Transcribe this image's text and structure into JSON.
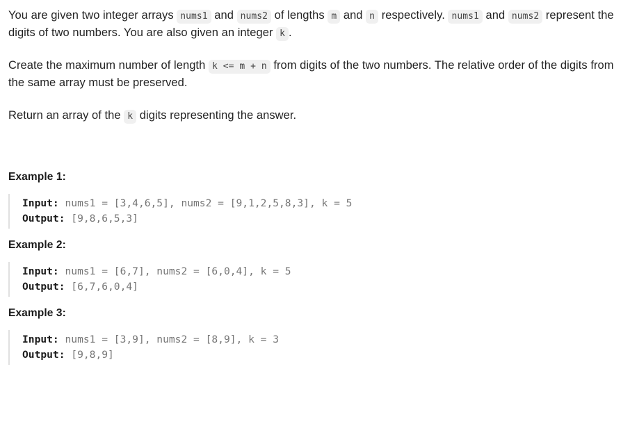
{
  "problem": {
    "paragraphs": [
      {
        "id": "p1",
        "segments": [
          {
            "type": "text",
            "value": "You are given two integer arrays "
          },
          {
            "type": "code",
            "value": "nums1"
          },
          {
            "type": "text",
            "value": " and "
          },
          {
            "type": "code",
            "value": "nums2"
          },
          {
            "type": "text",
            "value": " of lengths "
          },
          {
            "type": "code",
            "value": "m"
          },
          {
            "type": "text",
            "value": " and "
          },
          {
            "type": "code",
            "value": "n"
          },
          {
            "type": "text",
            "value": " respectively. "
          },
          {
            "type": "code",
            "value": "nums1"
          },
          {
            "type": "text",
            "value": " and "
          },
          {
            "type": "code",
            "value": "nums2"
          },
          {
            "type": "text",
            "value": " represent the digits of two numbers. You are also given an integer "
          },
          {
            "type": "code",
            "value": "k"
          },
          {
            "type": "text",
            "value": "."
          }
        ]
      },
      {
        "id": "p2",
        "segments": [
          {
            "type": "text",
            "value": "Create the maximum number of length "
          },
          {
            "type": "code",
            "value": "k <= m + n"
          },
          {
            "type": "text",
            "value": " from digits of the two numbers. The relative order of the digits from the same array must be preserved."
          }
        ]
      },
      {
        "id": "p3",
        "segments": [
          {
            "type": "text",
            "value": "Return an array of the "
          },
          {
            "type": "code",
            "value": "k"
          },
          {
            "type": "text",
            "value": " digits representing the answer."
          }
        ]
      }
    ],
    "examples": [
      {
        "title": "Example 1:",
        "input_label": "Input:",
        "input_value": " nums1 = [3,4,6,5], nums2 = [9,1,2,5,8,3], k = 5",
        "output_label": "Output:",
        "output_value": " [9,8,6,5,3]"
      },
      {
        "title": "Example 2:",
        "input_label": "Input:",
        "input_value": " nums1 = [6,7], nums2 = [6,0,4], k = 5",
        "output_label": "Output:",
        "output_value": " [6,7,6,0,4]"
      },
      {
        "title": "Example 3:",
        "input_label": "Input:",
        "input_value": " nums1 = [3,9], nums2 = [8,9], k = 3",
        "output_label": "Output:",
        "output_value": " [9,8,9]"
      }
    ]
  },
  "colors": {
    "body_text": "#242424",
    "code_text": "#767676",
    "chip_bg": "#f0f0f0",
    "chip_text": "#454545",
    "border": "#e0e0e0",
    "heading": "#1a1a1a",
    "background": "#ffffff"
  }
}
